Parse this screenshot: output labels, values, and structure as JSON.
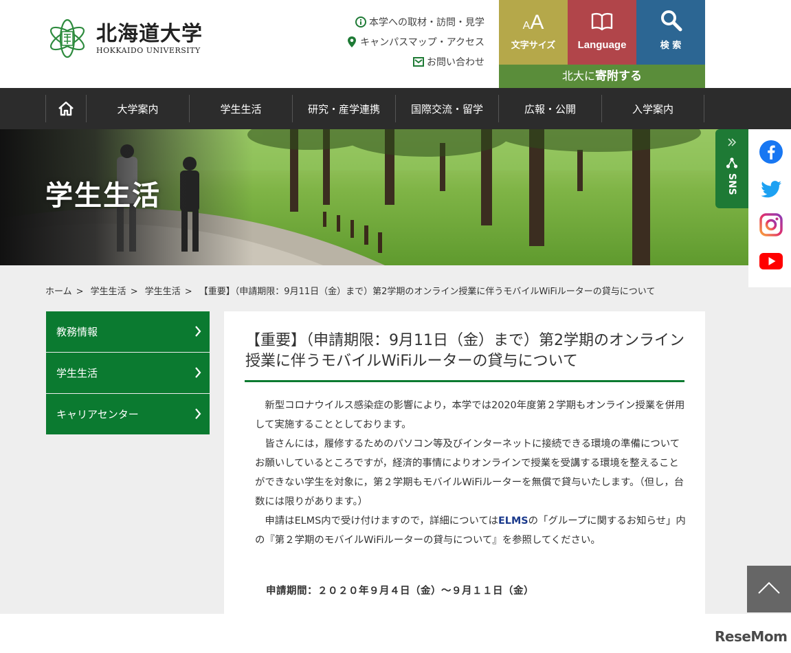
{
  "header": {
    "logo_jp": "北海道大学",
    "logo_en": "HOKKAIDO UNIVERSITY",
    "util_links": [
      {
        "label": "本学への取材・訪問・見学",
        "icon": "info-icon"
      },
      {
        "label": "キャンパスマップ・アクセス",
        "icon": "map-pin-icon"
      },
      {
        "label": "お問い合わせ",
        "icon": "mail-icon"
      }
    ],
    "font_size_label": "文字サイズ",
    "font_size_glyph_small": "A",
    "font_size_glyph_large": "A",
    "language_label": "Language",
    "search_label": "検 索",
    "donate_prefix": "北大に",
    "donate_bold": "寄附する",
    "colors": {
      "font": "#b5a84a",
      "language": "#b1454a",
      "search": "#2c6693",
      "donate": "#5a8d3a"
    }
  },
  "nav": {
    "home_icon": "home-icon",
    "items": [
      "大学案内",
      "学生生活",
      "研究・産学連携",
      "国際交流・留学",
      "広報・公開",
      "入学案内"
    ]
  },
  "hero": {
    "title": "学生生活"
  },
  "sns": {
    "tab_label": "SNS",
    "icons": [
      "facebook-icon",
      "twitter-icon",
      "instagram-icon",
      "youtube-icon"
    ]
  },
  "breadcrumb": [
    "ホーム",
    "学生生活",
    "学生生活",
    "【重要】（申請期限：9月11日（金）まで）第2学期のオンライン授業に伴うモバイルWiFiルーターの貸与について"
  ],
  "breadcrumb_sep": ">",
  "side_menu": [
    "教務情報",
    "学生生活",
    "キャリアセンター"
  ],
  "article": {
    "title": "【重要】（申請期限：9月11日（金）まで）第2学期のオンライン授業に伴うモバイルWiFiルーターの貸与について",
    "p1": "新型コロナウイルス感染症の影響により，本学では2020年度第２学期もオンライン授業を併用して実施することとしております。",
    "p2": "皆さんには，履修するためのパソコン等及びインターネットに接続できる環境の準備についてお願いしているところですが，経済的事情によりオンラインで授業を受講する環境を整えることができない学生を対象に，第２学期もモバイルWiFiルーターを無償で貸与いたします。（但し，台数には限りがあります。）",
    "p3_before": "申請はELMS内で受け付けますので，詳細については",
    "p3_link": "ELMS",
    "p3_after": "の「グループに関するお知らせ」内の『第２学期のモバイルWiFiルーターの貸与について』を参照してください。",
    "period": "申請期間：２０２０年９月４日（金）～９月１１日（金）"
  },
  "watermark": "ReseMom"
}
